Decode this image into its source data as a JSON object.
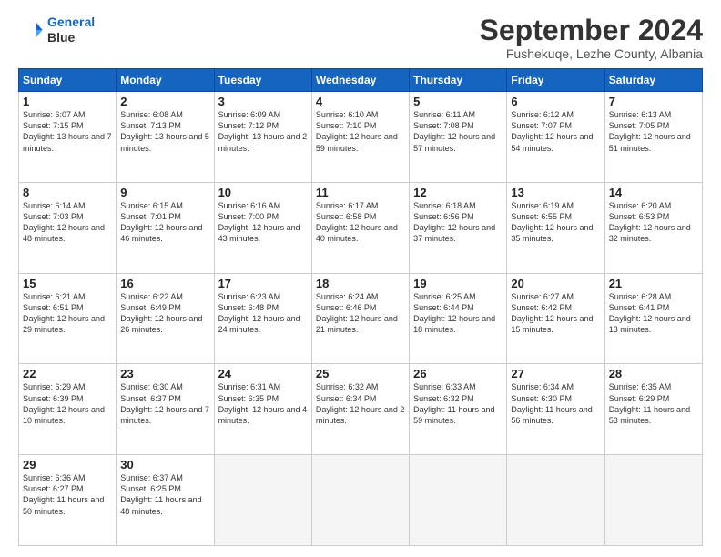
{
  "logo": {
    "line1": "General",
    "line2": "Blue"
  },
  "title": "September 2024",
  "subtitle": "Fushekuqe, Lezhe County, Albania",
  "days_header": [
    "Sunday",
    "Monday",
    "Tuesday",
    "Wednesday",
    "Thursday",
    "Friday",
    "Saturday"
  ],
  "weeks": [
    [
      {
        "day": "1",
        "sunrise": "6:07 AM",
        "sunset": "7:15 PM",
        "daylight": "13 hours and 7 minutes."
      },
      {
        "day": "2",
        "sunrise": "6:08 AM",
        "sunset": "7:13 PM",
        "daylight": "13 hours and 5 minutes."
      },
      {
        "day": "3",
        "sunrise": "6:09 AM",
        "sunset": "7:12 PM",
        "daylight": "13 hours and 2 minutes."
      },
      {
        "day": "4",
        "sunrise": "6:10 AM",
        "sunset": "7:10 PM",
        "daylight": "12 hours and 59 minutes."
      },
      {
        "day": "5",
        "sunrise": "6:11 AM",
        "sunset": "7:08 PM",
        "daylight": "12 hours and 57 minutes."
      },
      {
        "day": "6",
        "sunrise": "6:12 AM",
        "sunset": "7:07 PM",
        "daylight": "12 hours and 54 minutes."
      },
      {
        "day": "7",
        "sunrise": "6:13 AM",
        "sunset": "7:05 PM",
        "daylight": "12 hours and 51 minutes."
      }
    ],
    [
      {
        "day": "8",
        "sunrise": "6:14 AM",
        "sunset": "7:03 PM",
        "daylight": "12 hours and 48 minutes."
      },
      {
        "day": "9",
        "sunrise": "6:15 AM",
        "sunset": "7:01 PM",
        "daylight": "12 hours and 46 minutes."
      },
      {
        "day": "10",
        "sunrise": "6:16 AM",
        "sunset": "7:00 PM",
        "daylight": "12 hours and 43 minutes."
      },
      {
        "day": "11",
        "sunrise": "6:17 AM",
        "sunset": "6:58 PM",
        "daylight": "12 hours and 40 minutes."
      },
      {
        "day": "12",
        "sunrise": "6:18 AM",
        "sunset": "6:56 PM",
        "daylight": "12 hours and 37 minutes."
      },
      {
        "day": "13",
        "sunrise": "6:19 AM",
        "sunset": "6:55 PM",
        "daylight": "12 hours and 35 minutes."
      },
      {
        "day": "14",
        "sunrise": "6:20 AM",
        "sunset": "6:53 PM",
        "daylight": "12 hours and 32 minutes."
      }
    ],
    [
      {
        "day": "15",
        "sunrise": "6:21 AM",
        "sunset": "6:51 PM",
        "daylight": "12 hours and 29 minutes."
      },
      {
        "day": "16",
        "sunrise": "6:22 AM",
        "sunset": "6:49 PM",
        "daylight": "12 hours and 26 minutes."
      },
      {
        "day": "17",
        "sunrise": "6:23 AM",
        "sunset": "6:48 PM",
        "daylight": "12 hours and 24 minutes."
      },
      {
        "day": "18",
        "sunrise": "6:24 AM",
        "sunset": "6:46 PM",
        "daylight": "12 hours and 21 minutes."
      },
      {
        "day": "19",
        "sunrise": "6:25 AM",
        "sunset": "6:44 PM",
        "daylight": "12 hours and 18 minutes."
      },
      {
        "day": "20",
        "sunrise": "6:27 AM",
        "sunset": "6:42 PM",
        "daylight": "12 hours and 15 minutes."
      },
      {
        "day": "21",
        "sunrise": "6:28 AM",
        "sunset": "6:41 PM",
        "daylight": "12 hours and 13 minutes."
      }
    ],
    [
      {
        "day": "22",
        "sunrise": "6:29 AM",
        "sunset": "6:39 PM",
        "daylight": "12 hours and 10 minutes."
      },
      {
        "day": "23",
        "sunrise": "6:30 AM",
        "sunset": "6:37 PM",
        "daylight": "12 hours and 7 minutes."
      },
      {
        "day": "24",
        "sunrise": "6:31 AM",
        "sunset": "6:35 PM",
        "daylight": "12 hours and 4 minutes."
      },
      {
        "day": "25",
        "sunrise": "6:32 AM",
        "sunset": "6:34 PM",
        "daylight": "12 hours and 2 minutes."
      },
      {
        "day": "26",
        "sunrise": "6:33 AM",
        "sunset": "6:32 PM",
        "daylight": "11 hours and 59 minutes."
      },
      {
        "day": "27",
        "sunrise": "6:34 AM",
        "sunset": "6:30 PM",
        "daylight": "11 hours and 56 minutes."
      },
      {
        "day": "28",
        "sunrise": "6:35 AM",
        "sunset": "6:29 PM",
        "daylight": "11 hours and 53 minutes."
      }
    ],
    [
      {
        "day": "29",
        "sunrise": "6:36 AM",
        "sunset": "6:27 PM",
        "daylight": "11 hours and 50 minutes."
      },
      {
        "day": "30",
        "sunrise": "6:37 AM",
        "sunset": "6:25 PM",
        "daylight": "11 hours and 48 minutes."
      },
      null,
      null,
      null,
      null,
      null
    ]
  ]
}
